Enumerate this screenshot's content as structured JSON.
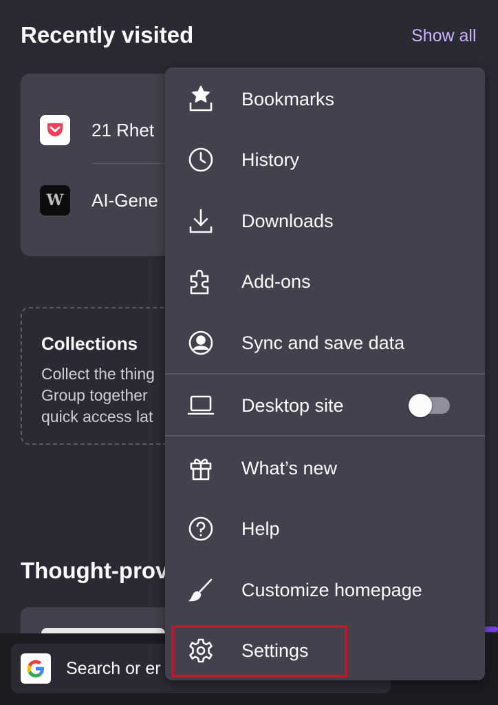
{
  "recently_visited": {
    "title": "Recently visited",
    "show_all": "Show all",
    "items": [
      {
        "label": "21 Rhet",
        "icon": "pocket-icon"
      },
      {
        "label": "AI-Gene",
        "icon": "w-logo-icon",
        "glyph": "W"
      }
    ]
  },
  "collections": {
    "title": "Collections",
    "lines": [
      "Collect the thing",
      "Group together",
      "quick access lat"
    ]
  },
  "thought_provoking": {
    "title": "Thought-prov"
  },
  "search_bar": {
    "text": "Search or er",
    "engine": "G"
  },
  "menu": {
    "items": [
      {
        "label": "Bookmarks",
        "icon": "bookmark-star-icon"
      },
      {
        "label": "History",
        "icon": "clock-icon"
      },
      {
        "label": "Downloads",
        "icon": "download-icon"
      },
      {
        "label": "Add-ons",
        "icon": "puzzle-icon"
      },
      {
        "label": "Sync and save data",
        "icon": "account-icon"
      },
      {
        "label": "Desktop site",
        "icon": "laptop-icon",
        "toggle_on": false
      },
      {
        "label": "What’s new",
        "icon": "gift-icon"
      },
      {
        "label": "Help",
        "icon": "help-icon"
      },
      {
        "label": "Customize homepage",
        "icon": "paintbrush-icon"
      },
      {
        "label": "Settings",
        "icon": "gear-icon",
        "highlighted": true
      }
    ]
  },
  "colors": {
    "background": "#2b2a33",
    "card": "#42414d",
    "accent_link": "#c9b3ff",
    "highlight_border": "#c0152b"
  }
}
